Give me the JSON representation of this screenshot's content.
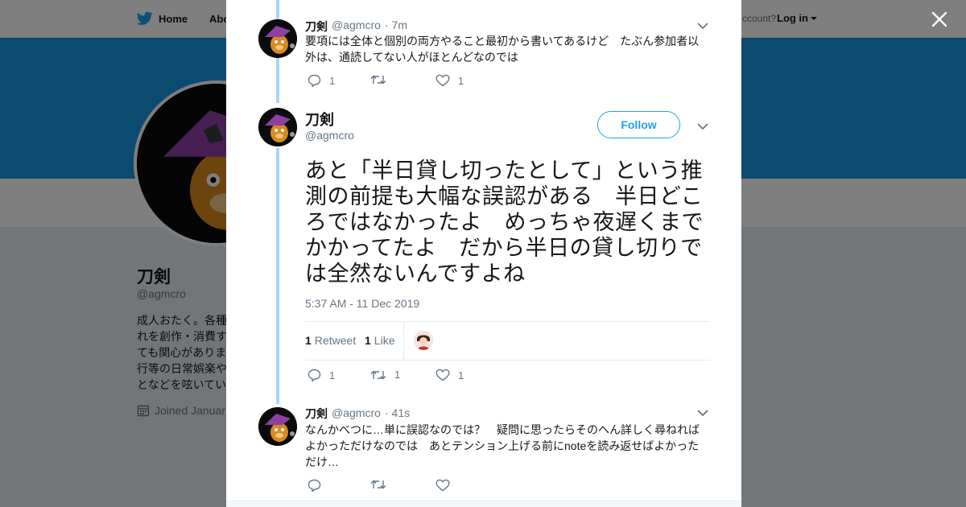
{
  "nav": {
    "home_label": "Home",
    "about_label": "Abo",
    "account_text": "ccount?",
    "login_label": "Log in"
  },
  "profile": {
    "name": "刀剣",
    "handle": "@agmcro",
    "bio": "成人おたく。各種\nれを創作・消費す\nても関心がありま\n行等の日常娯楽や\nとなどを呟いてい",
    "joined": "Joined Januar"
  },
  "colors": {
    "accent": "#1da1f2",
    "banner": "#1b95e0",
    "thread_line": "#a8d5f5",
    "text": "#14171a",
    "muted": "#657786"
  },
  "tweets": [
    {
      "name": "刀剣",
      "handle": "@agmcro",
      "time": "· 7m",
      "text": "要項には全体と個別の両方やること最初から書いてあるけど　たぶん参加者以外は、通読してない人がほとんどなのでは",
      "replies": "1",
      "retweets": "",
      "likes": "1"
    },
    {
      "name": "刀剣",
      "handle": "@agmcro",
      "time": "· 41s",
      "text": "なんかべつに…単に誤認なのでは？　疑問に思ったらそのへん詳しく尋ねればよかっただけなのでは　あとテンション上げる前にnoteを読み返せばよかっただけ…",
      "replies": "",
      "retweets": "",
      "likes": ""
    }
  ],
  "main_tweet": {
    "name": "刀剣",
    "handle": "@agmcro",
    "follow_label": "Follow",
    "text": "あと「半日貸し切ったとして」という推測の前提も大幅な誤認がある　半日どころではなかったよ　めっちゃ夜遅くまでかかってたよ　だから半日の貸し切りでは全然ないんですよね",
    "timestamp": "5:37 AM - 11 Dec 2019",
    "retweet_count": "1",
    "retweet_label": "Retweet",
    "like_count": "1",
    "like_label": "Like",
    "replies": "1",
    "retweets": "1",
    "likes": "1"
  },
  "icons": [
    "twitter-bird-icon",
    "close-icon",
    "caret-down-icon",
    "reply-icon",
    "retweet-icon",
    "heart-icon",
    "calendar-icon"
  ]
}
